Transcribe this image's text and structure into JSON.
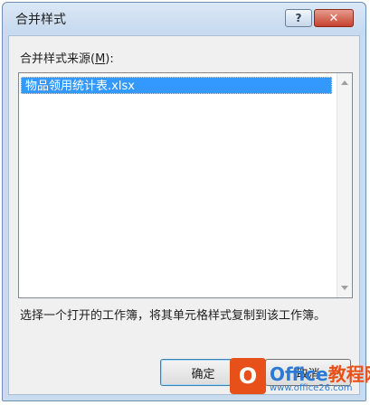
{
  "dialog": {
    "title": "合并样式",
    "help_label": "?",
    "close_label": "✕",
    "list_label_prefix": "合并样式来源(",
    "list_label_accel": "M",
    "list_label_suffix": "):",
    "items": [
      "物品领用统计表.xlsx"
    ],
    "description": "选择一个打开的工作簿，将其单元格样式复制到该工作簿。",
    "ok_label": "确定",
    "cancel_label": "取消"
  },
  "watermark": {
    "logo_char": "O",
    "brand_main": "Office",
    "brand_accent": "教程网",
    "url": "www.office26.com"
  },
  "colors": {
    "selection": "#3399ff",
    "close_button": "#c5422d",
    "titlebar": "#c9dcef"
  }
}
